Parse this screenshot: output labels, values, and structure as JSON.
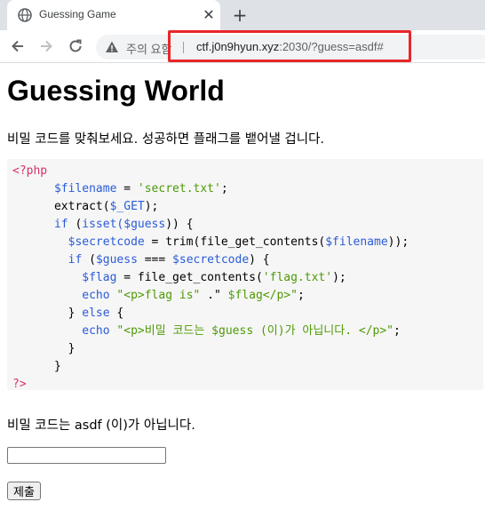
{
  "browser": {
    "tab_title": "Guessing Game",
    "tab_close": "✕",
    "new_tab": "+",
    "security_warning": "주의 요함",
    "url_host": "ctf.j0n9hyun.xyz",
    "url_rest": ":2030/?guess=asdf#",
    "highlight_color": "#e8262a"
  },
  "page": {
    "title": "Guessing World",
    "intro": "비밀 코드를 맞춰보세요. 성공하면 플래그를 뱉어낼 겁니다.",
    "code": {
      "open_tag": "<?php",
      "filename_var": "$filename",
      "filename_val": "'secret.txt'",
      "extract_fn": "extract(",
      "get_var": "$_GET",
      "if_kw": "if",
      "isset_fn": "isset(",
      "guess_var": "$guess",
      "secretcode_var": "$secretcode",
      "trim_fn": "trim(file_get_contents(",
      "flag_var": "$flag",
      "fgc_fn": "file_get_contents(",
      "flag_txt": "'flag.txt'",
      "echo_kw": "echo",
      "echo1_str_a": "\"<p>flag is\"",
      "echo1_mid": " .\" ",
      "echo1_str_b": "$flag</p>\"",
      "else_kw": "else",
      "echo2_str": "\"<p>비밀 코드는 $guess (이)가 아닙니다. </p>\"",
      "close_tag": "?>"
    },
    "result_text": "비밀 코드는 asdf (이)가 아닙니다.",
    "guess_input_value": "",
    "submit_label": "제출"
  }
}
